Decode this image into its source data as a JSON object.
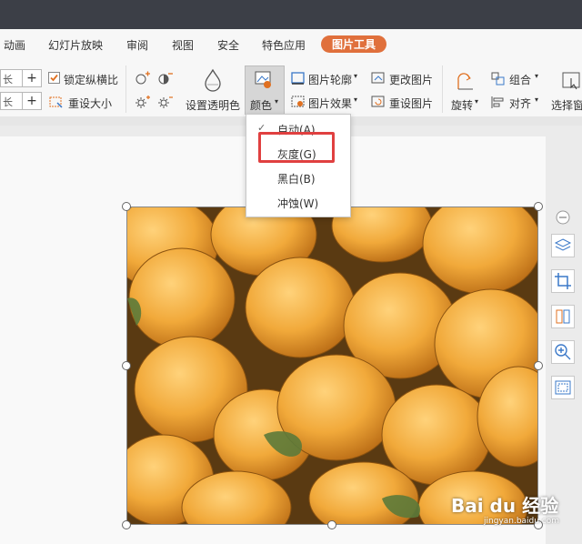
{
  "menubar": {
    "items": [
      "动画",
      "幻灯片放映",
      "审阅",
      "视图",
      "安全",
      "特色应用",
      "图片工具"
    ],
    "active": "图片工具",
    "active_color": "#e0703c"
  },
  "ribbon": {
    "spin_unit": "长",
    "plus": "+",
    "lock_ratio": "锁定纵横比",
    "reset_size": "重设大小",
    "set_transparent": "设置透明色",
    "color_button": "颜色",
    "picture_outline": "图片轮廓",
    "picture_effect": "图片效果",
    "change_picture": "更改图片",
    "reset_picture": "重设图片",
    "rotate": "旋转",
    "group": "组合",
    "align": "对齐",
    "selection_pane": "选择窗"
  },
  "color_menu": {
    "items": [
      {
        "label": "自动(A)",
        "checked": true
      },
      {
        "label": "灰度(G)",
        "checked": false
      },
      {
        "label": "黑白(B)",
        "checked": false
      },
      {
        "label": "冲蚀(W)",
        "checked": false
      }
    ],
    "highlight_color": "#e04040"
  },
  "watermark": {
    "brand": "Bai du 经验",
    "url": "jingyan.baidu.com"
  }
}
